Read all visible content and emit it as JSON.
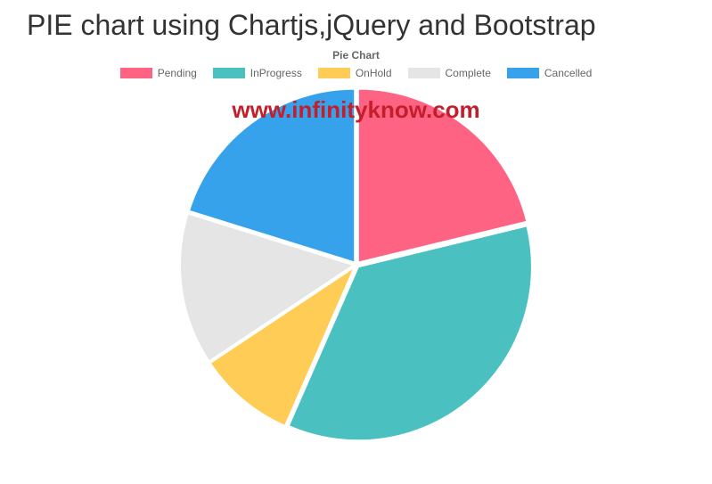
{
  "page_title": "PIE chart using Chartjs,jQuery and Bootstrap",
  "chart_title": "Pie Chart",
  "watermark": "www.infinityknow.com",
  "legend": [
    {
      "label": "Pending",
      "color": "#ff6384"
    },
    {
      "label": "InProgress",
      "color": "#4bc0c0"
    },
    {
      "label": "OnHold",
      "color": "#ffcd56"
    },
    {
      "label": "Complete",
      "color": "#e5e5e5"
    },
    {
      "label": "Cancelled",
      "color": "#36a2eb"
    }
  ],
  "chart_data": {
    "type": "pie",
    "title": "Pie Chart",
    "categories": [
      "Pending",
      "InProgress",
      "OnHold",
      "Complete",
      "Cancelled"
    ],
    "values": [
      21,
      35,
      9,
      14,
      20
    ],
    "colors": [
      "#ff6384",
      "#4bc0c0",
      "#ffcd56",
      "#e5e5e5",
      "#36a2eb"
    ]
  }
}
